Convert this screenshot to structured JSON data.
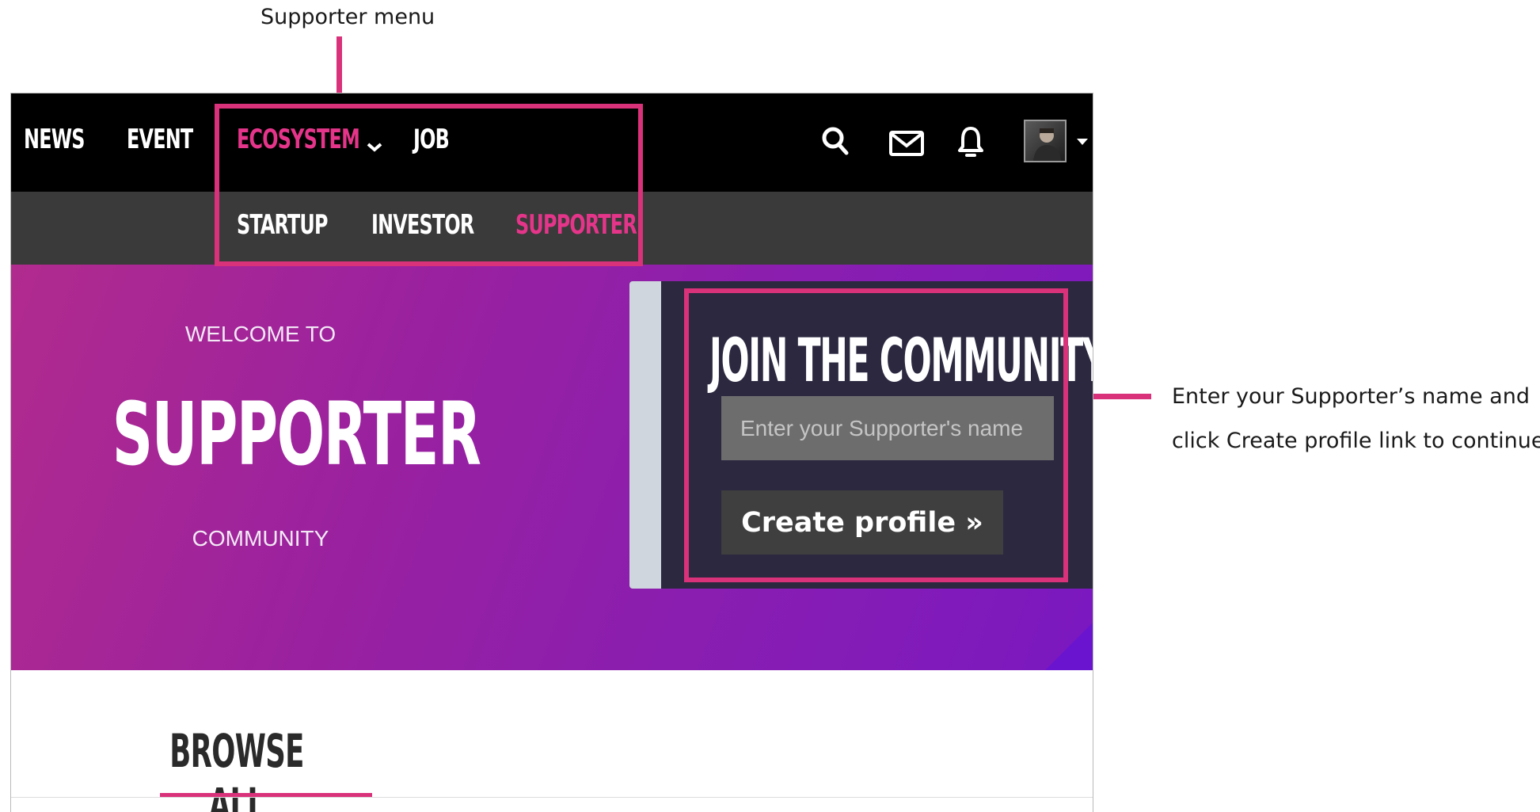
{
  "annotations": {
    "menu_callout": "Supporter menu",
    "form_callout_line1": "Enter your Supporter’s name and",
    "form_callout_line2": "click Create profile link to continue"
  },
  "nav": {
    "items": [
      "NEWS",
      "EVENT",
      "ECOSYSTEM",
      "JOB"
    ],
    "active_item": "ECOSYSTEM",
    "sub_items": [
      "STARTUP",
      "INVESTOR",
      "SUPPORTER"
    ],
    "active_sub_item": "SUPPORTER",
    "icons": [
      "search-icon",
      "mail-icon",
      "bell-icon",
      "avatar",
      "caret-down-icon"
    ]
  },
  "hero": {
    "welcome": "WELCOME TO",
    "title": "SUPPORTER",
    "subtitle": "COMMUNITY"
  },
  "join": {
    "title": "JOIN THE COMMUNITY",
    "input_placeholder": "Enter your Supporter's name",
    "input_value": "",
    "button_label": "Create profile »"
  },
  "browse": {
    "tab_label": "BROWSE ALL"
  },
  "colors": {
    "accent": "#d9317a",
    "nav_active": "#e5358a",
    "topbar": "#000000",
    "subbar": "#3a3a3a",
    "panel": "#2b2840"
  }
}
